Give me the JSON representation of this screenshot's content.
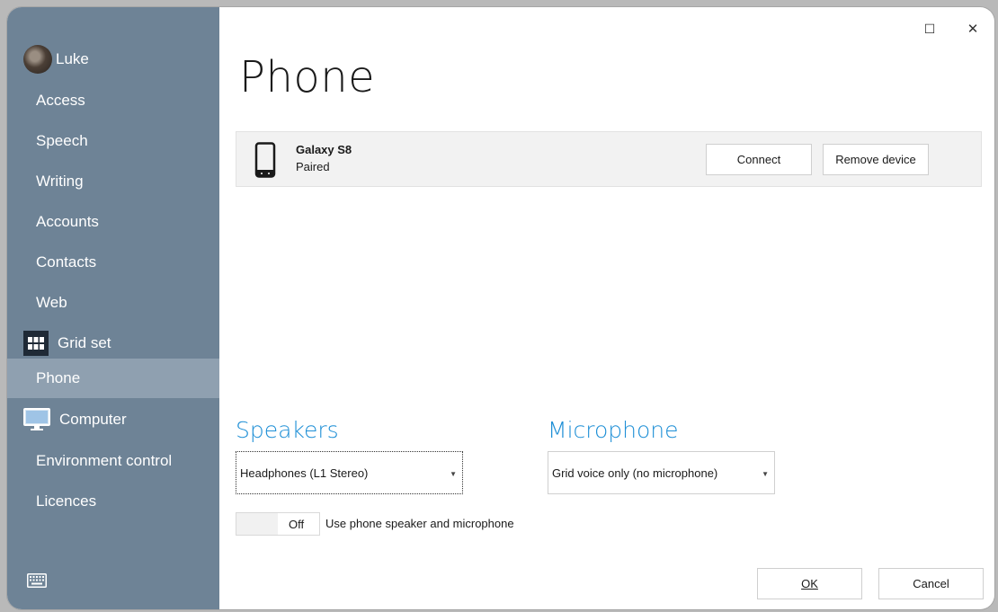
{
  "sidebar": {
    "user": {
      "name": "Luke"
    },
    "items": [
      {
        "label": "Access"
      },
      {
        "label": "Speech"
      },
      {
        "label": "Writing"
      },
      {
        "label": "Accounts"
      },
      {
        "label": "Contacts"
      },
      {
        "label": "Web"
      },
      {
        "label": "Grid set",
        "icon": "grid-icon"
      },
      {
        "label": "Phone",
        "selected": true
      },
      {
        "label": "Computer",
        "icon": "monitor-icon"
      },
      {
        "label": "Environment control"
      },
      {
        "label": "Licences"
      }
    ],
    "bottom_icon": "keyboard-icon"
  },
  "window_controls": {
    "maximize": "☐",
    "close": "✕"
  },
  "page": {
    "title": "Phone"
  },
  "device": {
    "name": "Galaxy S8",
    "status": "Paired",
    "connect_label": "Connect",
    "remove_label": "Remove device",
    "icon": "smartphone-icon"
  },
  "speakers": {
    "title": "Speakers",
    "selected": "Headphones (L1 Stereo)"
  },
  "microphone": {
    "title": "Microphone",
    "selected": "Grid voice only (no microphone)"
  },
  "phone_audio_toggle": {
    "state": "Off",
    "label": "Use phone speaker and microphone"
  },
  "footer": {
    "ok_label": "OK",
    "cancel_label": "Cancel"
  },
  "colors": {
    "sidebar_bg": "#6e8396",
    "sidebar_selected": "#8fa0b0",
    "accent": "#1e8fd6"
  }
}
